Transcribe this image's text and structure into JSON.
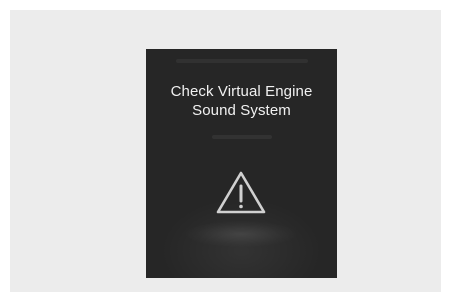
{
  "display": {
    "message_line1": "Check Virtual Engine",
    "message_line2": "Sound System",
    "icon": "warning-triangle-icon"
  },
  "colors": {
    "background": "#ececec",
    "screen": "#262626",
    "text": "#f1f1f1",
    "icon": "#d0d0d0"
  }
}
